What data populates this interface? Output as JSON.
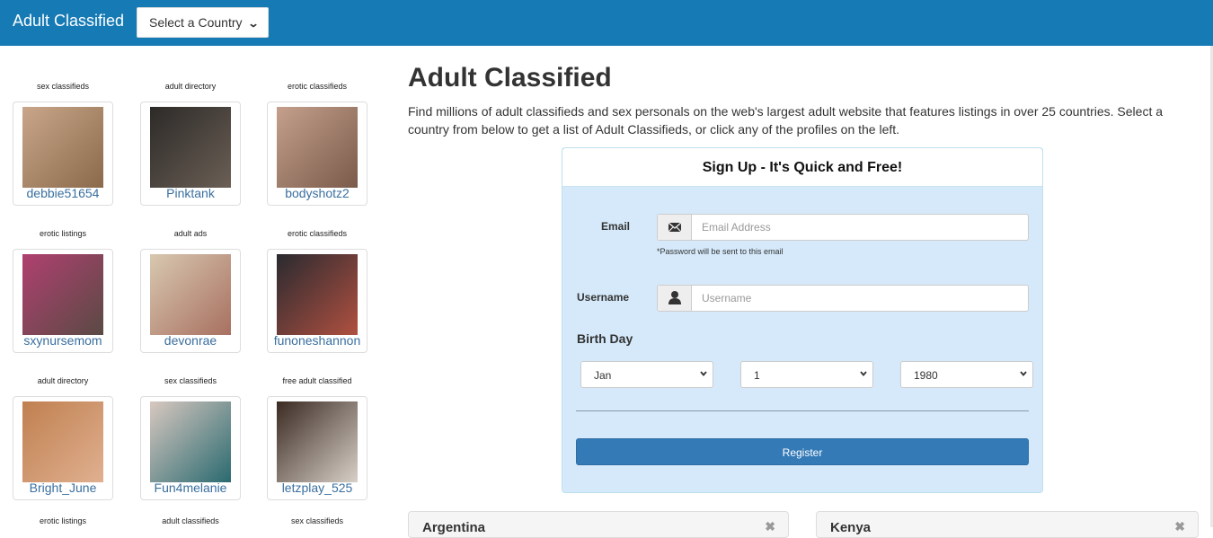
{
  "navbar": {
    "brand": "Adult Classified",
    "country_select_label": "Select a Country",
    "bg_color": "#167ab5"
  },
  "profiles": [
    {
      "category": "sex classifieds",
      "username": "debbie51654",
      "photo_tone": [
        "#c9a68a",
        "#8a6a4a"
      ]
    },
    {
      "category": "adult directory",
      "username": "Pinktank",
      "photo_tone": [
        "#2c2a28",
        "#6b5f55"
      ]
    },
    {
      "category": "erotic classifieds",
      "username": "bodyshotz2",
      "photo_tone": [
        "#c4a08c",
        "#7a5a4a"
      ]
    },
    {
      "category": "erotic listings",
      "username": "sxynursemom",
      "photo_tone": [
        "#b04070",
        "#5a4a44"
      ]
    },
    {
      "category": "adult ads",
      "username": "devonrae",
      "photo_tone": [
        "#d8c8b0",
        "#a87060"
      ]
    },
    {
      "category": "erotic classifieds",
      "username": "funoneshannon",
      "photo_tone": [
        "#2a2a30",
        "#b05040"
      ]
    },
    {
      "category": "adult directory",
      "username": "Bright_June",
      "photo_tone": [
        "#c08050",
        "#e0b090"
      ]
    },
    {
      "category": "sex classifieds",
      "username": "Fun4melanie",
      "photo_tone": [
        "#d8c8c0",
        "#2a6a70"
      ]
    },
    {
      "category": "free adult classified",
      "username": "letzplay_525",
      "photo_tone": [
        "#3a2a22",
        "#d8d0c8"
      ]
    },
    {
      "category": "erotic listings",
      "username": "",
      "photo_tone": [
        "#ffffff",
        "#ffffff"
      ]
    },
    {
      "category": "adult classifieds",
      "username": "",
      "photo_tone": [
        "#ffffff",
        "#ffffff"
      ]
    },
    {
      "category": "sex classifieds",
      "username": "",
      "photo_tone": [
        "#ffffff",
        "#ffffff"
      ]
    }
  ],
  "main": {
    "title": "Adult Classified",
    "intro": "Find millions of adult classifieds and sex personals on the web's largest adult website that features listings in over 25 countries. Select a country from below to get a list of Adult Classifieds, or click any of the profiles on the left."
  },
  "signup": {
    "heading": "Sign Up - It's Quick and Free!",
    "email_label": "Email",
    "email_placeholder": "Email Address",
    "email_value": "",
    "email_icon": "envelope-icon",
    "password_hint": "*Password will be sent to this email",
    "username_label": "Username",
    "username_placeholder": "Username",
    "username_value": "",
    "username_icon": "user-icon",
    "birthday_label": "Birth Day",
    "month_selected": "Jan",
    "day_selected": "1",
    "year_selected": "1980",
    "register_label": "Register",
    "panel_bg": "#d5e9fa",
    "button_color": "#337ab7"
  },
  "country_panels": [
    {
      "name": "Argentina",
      "icon": "collapse-icon"
    },
    {
      "name": "Kenya",
      "icon": "collapse-icon"
    }
  ]
}
